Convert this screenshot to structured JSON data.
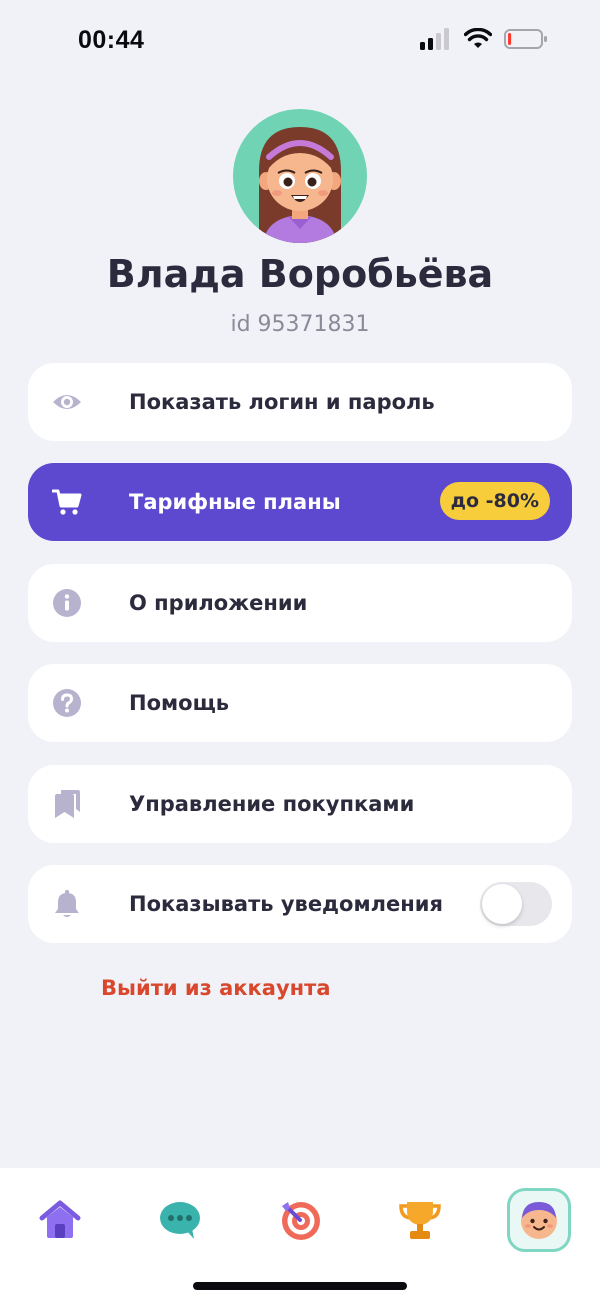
{
  "status_bar": {
    "time": "00:44",
    "signal_icon": "cellular-signal-icon",
    "wifi_icon": "wifi-icon",
    "battery_icon": "battery-low-icon",
    "battery_level": 0.1
  },
  "profile": {
    "avatar_icon": "girl-avatar-icon",
    "name": "Влада Воробьёва",
    "id_text": "id 95371831"
  },
  "menu": [
    {
      "icon": "eye-icon",
      "label": "Показать логин и пароль"
    },
    {
      "icon": "cart-icon",
      "label": "Тарифные планы",
      "badge": "до -80%"
    },
    {
      "icon": "info-icon",
      "label": "О приложении"
    },
    {
      "icon": "question-icon",
      "label": "Помощь"
    },
    {
      "icon": "bookmarks-icon",
      "label": "Управление покупками"
    },
    {
      "icon": "bell-icon",
      "label": "Показывать уведомления",
      "toggle": false
    }
  ],
  "logout_label": "Выйти из аккаунта",
  "bottom_nav": [
    {
      "icon": "home-icon",
      "active": false
    },
    {
      "icon": "chat-icon",
      "active": false
    },
    {
      "icon": "target-icon",
      "active": false
    },
    {
      "icon": "trophy-icon",
      "active": false
    },
    {
      "icon": "profile-avatar-icon",
      "active": true
    }
  ],
  "colors": {
    "background": "#f1f2f7",
    "accent": "#5d49cf",
    "badge": "#f8cd3c",
    "logout": "#d9472c",
    "icon_muted": "#b7b3cf",
    "nav_active_border": "#7fd6c3"
  }
}
